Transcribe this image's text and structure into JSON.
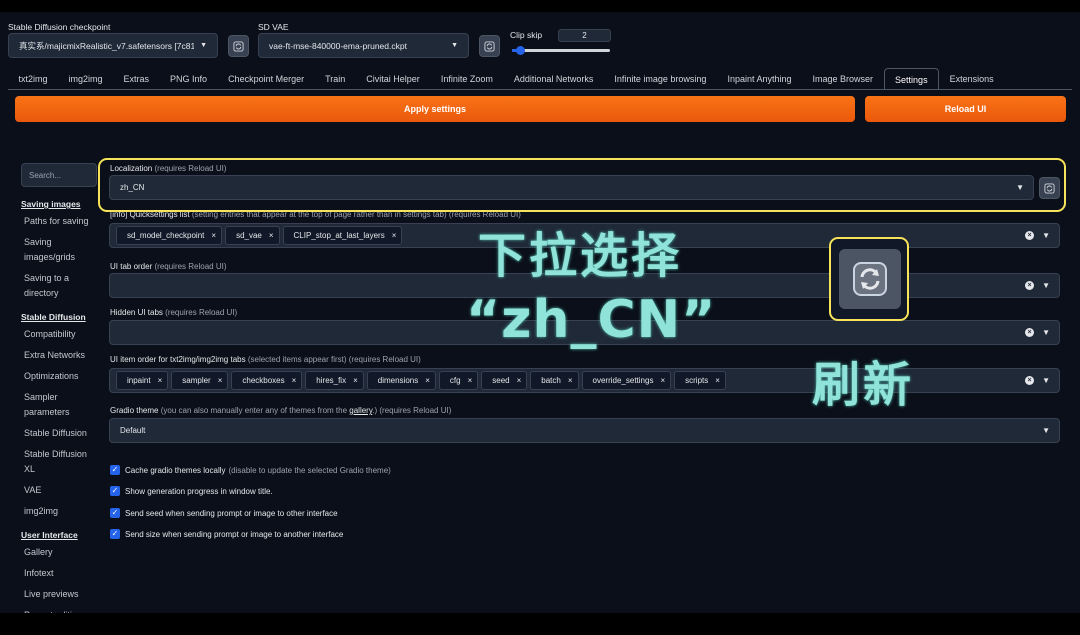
{
  "top": {
    "checkpoint_label": "Stable Diffusion checkpoint",
    "checkpoint_value": "真实系/majicmixRealistic_v7.safetensors [7c81",
    "vae_label": "SD VAE",
    "vae_value": "vae-ft-mse-840000-ema-pruned.ckpt",
    "clip_label": "Clip skip",
    "clip_value": "2",
    "clip_slider_fraction": 0.08
  },
  "tabs": [
    "txt2img",
    "img2img",
    "Extras",
    "PNG Info",
    "Checkpoint Merger",
    "Train",
    "Civitai Helper",
    "Infinite Zoom",
    "Additional Networks",
    "Infinite image browsing",
    "Inpaint Anything",
    "Image Browser",
    "Settings",
    "Extensions"
  ],
  "active_tab": "Settings",
  "buttons": {
    "apply": "Apply settings",
    "reload": "Reload UI"
  },
  "sidebar": {
    "search_placeholder": "Search...",
    "items": [
      {
        "type": "header",
        "label": "Saving images"
      },
      {
        "type": "item",
        "label": "Paths for saving"
      },
      {
        "type": "item",
        "label": "Saving images/grids"
      },
      {
        "type": "item",
        "label": "Saving to a directory"
      },
      {
        "type": "header",
        "label": "Stable Diffusion"
      },
      {
        "type": "item",
        "label": "Compatibility"
      },
      {
        "type": "item",
        "label": "Extra Networks"
      },
      {
        "type": "item",
        "label": "Optimizations"
      },
      {
        "type": "item",
        "label": "Sampler parameters"
      },
      {
        "type": "item",
        "label": "Stable Diffusion"
      },
      {
        "type": "item",
        "label": "Stable Diffusion XL"
      },
      {
        "type": "item",
        "label": "VAE"
      },
      {
        "type": "item",
        "label": "img2img"
      },
      {
        "type": "header",
        "label": "User Interface"
      },
      {
        "type": "item",
        "label": "Gallery"
      },
      {
        "type": "item",
        "label": "Infotext"
      },
      {
        "type": "item",
        "label": "Live previews"
      },
      {
        "type": "item",
        "label": "Prompt editing"
      }
    ]
  },
  "settings": {
    "localization": {
      "label": "Localization",
      "sub": "(requires Reload UI)",
      "value": "zh_CN"
    },
    "quicksettings": {
      "label": "[info] Quicksettings list",
      "sub": "(setting entries that appear at the top of page rather than in settings tab) (requires Reload UI)",
      "chips": [
        "sd_model_checkpoint",
        "sd_vae",
        "CLIP_stop_at_last_layers"
      ]
    },
    "tab_order": {
      "label": "UI tab order",
      "sub": "(requires Reload UI)"
    },
    "hidden_tabs": {
      "label": "Hidden UI tabs",
      "sub": "(requires Reload UI)"
    },
    "item_order": {
      "label": "UI item order for txt2img/img2img tabs",
      "sub": "(selected items appear first) (requires Reload UI)",
      "chips": [
        "inpaint",
        "sampler",
        "checkboxes",
        "hires_fix",
        "dimensions",
        "cfg",
        "seed",
        "batch",
        "override_settings",
        "scripts"
      ]
    },
    "gradio_theme": {
      "label": "Gradio theme",
      "sub_before": "(you can also manually enter any of themes from the",
      "link": "gallery",
      "sub_after": ".) (requires Reload UI)",
      "value": "Default"
    },
    "checkboxes": [
      {
        "label": "Cache gradio themes locally",
        "sub": "(disable to update the selected Gradio theme)",
        "checked": true
      },
      {
        "label": "Show generation progress in window title.",
        "sub": "",
        "checked": true
      },
      {
        "label": "Send seed when sending prompt or image to other interface",
        "sub": "",
        "checked": true
      },
      {
        "label": "Send size when sending prompt or image to another interface",
        "sub": "",
        "checked": true
      }
    ]
  },
  "overlay": {
    "line1": "下拉选择",
    "line2": "“zh_CN”",
    "refresh": "刷新",
    "highlight_color": "#f6e35a",
    "text_color": "#8fe3d8"
  },
  "colors": {
    "accent_orange": "#f97316",
    "accent_blue": "#2563eb",
    "background": "#0b0f19"
  }
}
